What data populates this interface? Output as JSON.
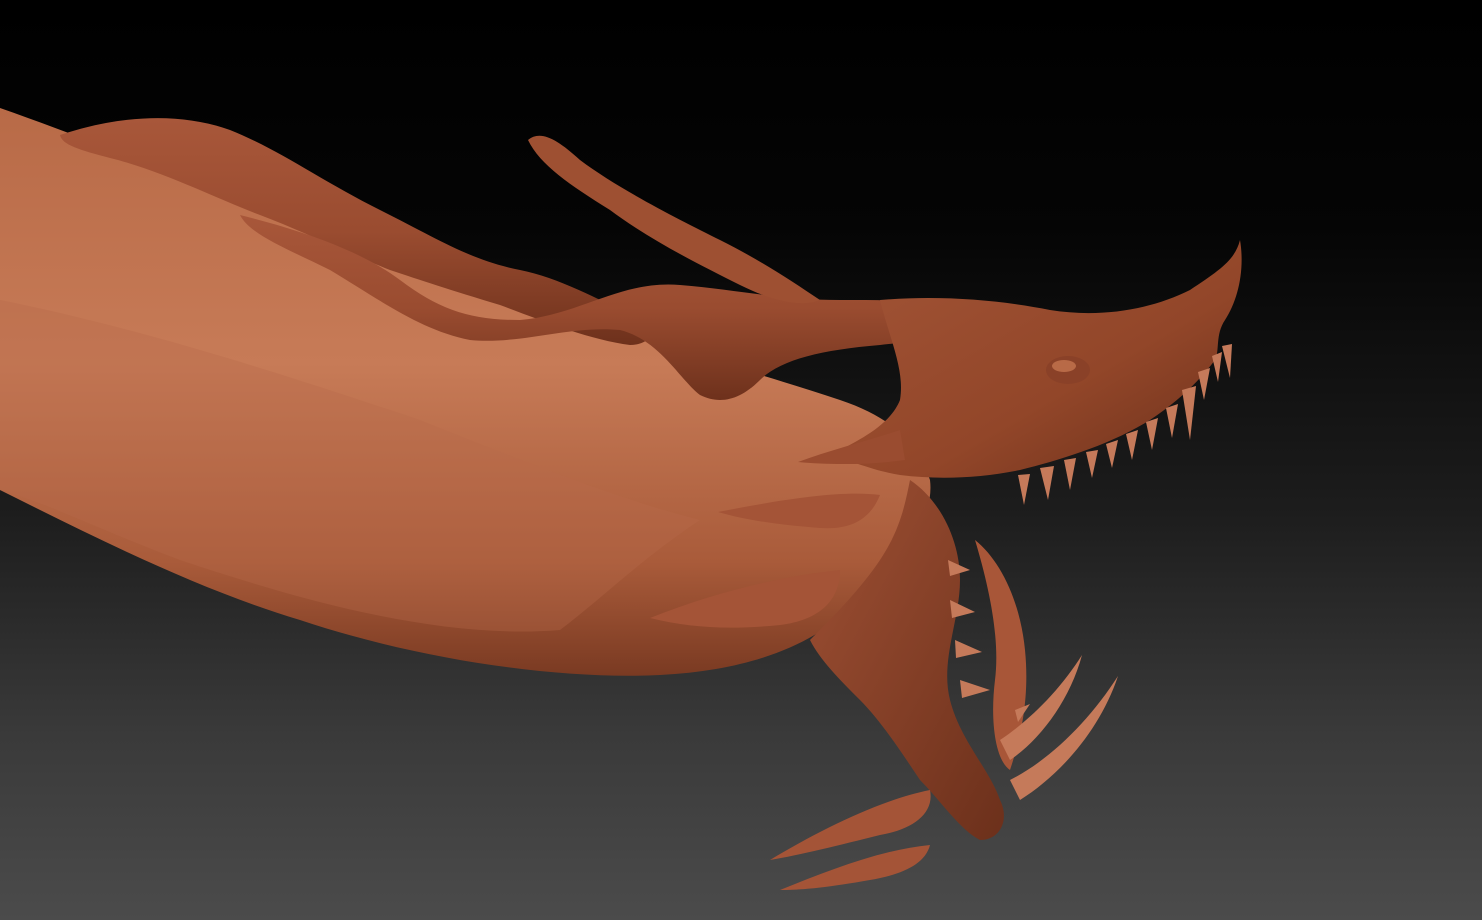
{
  "viewport": {
    "background_top": "#000000",
    "background_bottom": "#4b4b4b"
  },
  "model": {
    "material_color": "#b0603f",
    "highlight_color": "#cf8060",
    "shadow_color": "#5e2a18",
    "tooth_color": "#c47a5a"
  }
}
